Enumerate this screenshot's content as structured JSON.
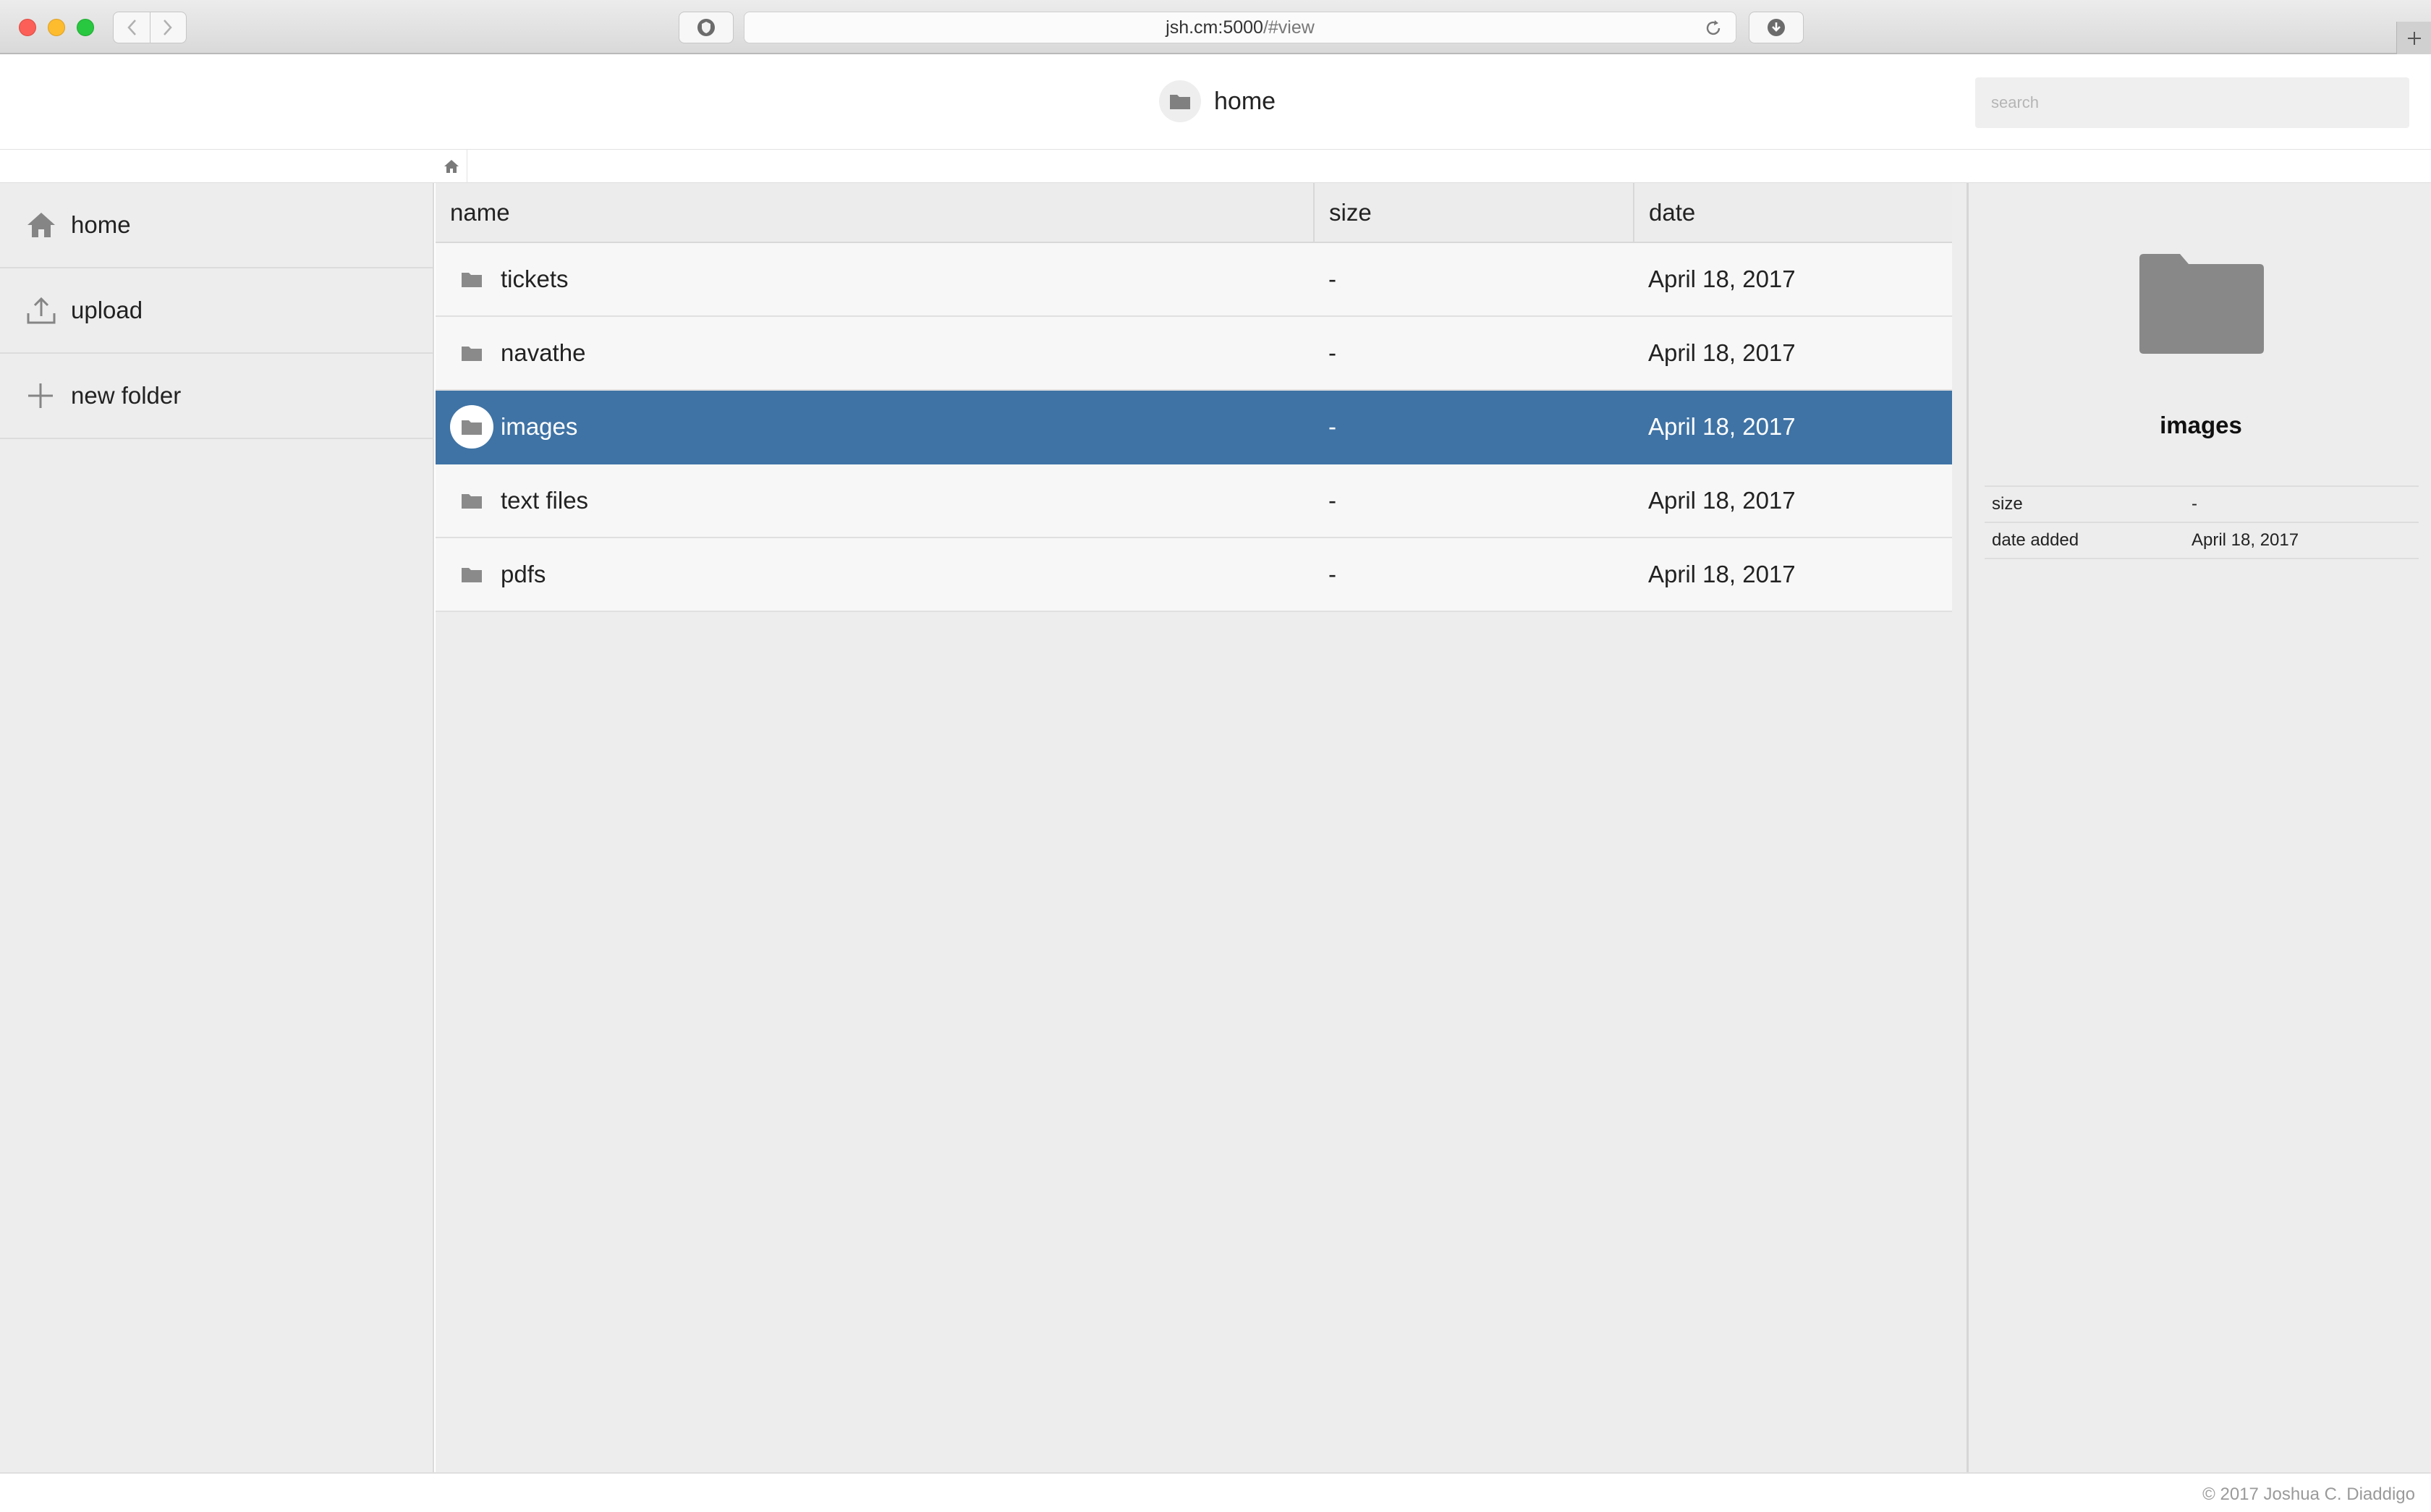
{
  "browser": {
    "url_host": "jsh.cm:5000",
    "url_path": "/#view"
  },
  "header": {
    "title": "home",
    "search_placeholder": "search"
  },
  "sidebar": {
    "items": [
      {
        "label": "home",
        "icon": "home-icon"
      },
      {
        "label": "upload",
        "icon": "upload-icon"
      },
      {
        "label": "new folder",
        "icon": "plus-icon"
      }
    ]
  },
  "table": {
    "columns": [
      "name",
      "size",
      "date"
    ],
    "rows": [
      {
        "name": "tickets",
        "size": "-",
        "date": "April 18, 2017",
        "selected": false
      },
      {
        "name": "navathe",
        "size": "-",
        "date": "April 18, 2017",
        "selected": false
      },
      {
        "name": "images",
        "size": "-",
        "date": "April 18, 2017",
        "selected": true
      },
      {
        "name": "text files",
        "size": "-",
        "date": "April 18, 2017",
        "selected": false
      },
      {
        "name": "pdfs",
        "size": "-",
        "date": "April 18, 2017",
        "selected": false
      }
    ]
  },
  "detail": {
    "name": "images",
    "props": [
      {
        "label": "size",
        "value": "-"
      },
      {
        "label": "date added",
        "value": "April 18, 2017"
      }
    ]
  },
  "footer": {
    "copyright": "© 2017 Joshua C. Diaddigo"
  },
  "colors": {
    "selected_row": "#3f73a5",
    "icon_gray": "#8a8a8a"
  }
}
